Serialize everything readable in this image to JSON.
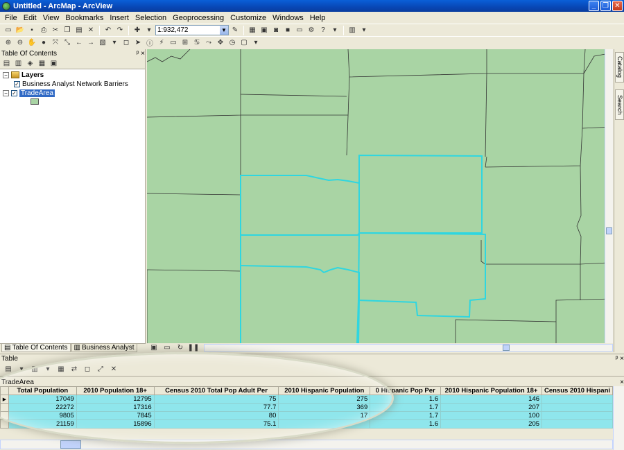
{
  "window": {
    "title": "Untitled - ArcMap - ArcView",
    "minimize": "_",
    "restore": "❐",
    "close": "✕"
  },
  "menu": [
    "File",
    "Edit",
    "View",
    "Bookmarks",
    "Insert",
    "Selection",
    "Geoprocessing",
    "Customize",
    "Windows",
    "Help"
  ],
  "toolbar": {
    "scale": "1:932,472"
  },
  "toc": {
    "title": "Table Of Contents",
    "pin": "ᵖ",
    "close": "×",
    "root_label": "Layers",
    "layers": [
      {
        "name": "Business Analyst Network Barriers",
        "checked": true,
        "selected": false
      },
      {
        "name": "TradeArea",
        "checked": true,
        "selected": true
      }
    ],
    "tabs": [
      "Table Of Contents",
      "Business Analyst"
    ]
  },
  "dock": {
    "catalog": "Catalog",
    "search": "Search"
  },
  "table_window": {
    "title": "Table",
    "tab_name": "TradeArea",
    "columns": [
      "Total Population",
      "2010 Population 18+",
      "Census 2010 Total Pop Adult Per",
      "2010 Hispanic Population",
      "0 Hispanic Pop Per",
      "2010 Hispanic Population 18+",
      "Census 2010 Hispani"
    ],
    "rows": [
      [
        "17049",
        "12795",
        "75",
        "275",
        "1.6",
        "146",
        ""
      ],
      [
        "22272",
        "17316",
        "77.7",
        "369",
        "1.7",
        "207",
        ""
      ],
      [
        "9805",
        "7845",
        "80",
        "17",
        "1.7",
        "100",
        ""
      ],
      [
        "21159",
        "15896",
        "75.1",
        "",
        "1.6",
        "205",
        ""
      ]
    ]
  },
  "colors": {
    "map_fill": "#a9d4a4",
    "selected_outline": "#2fd6e0",
    "table_highlight": "#8fe6ec",
    "titlebar": "#0a5fd8"
  }
}
